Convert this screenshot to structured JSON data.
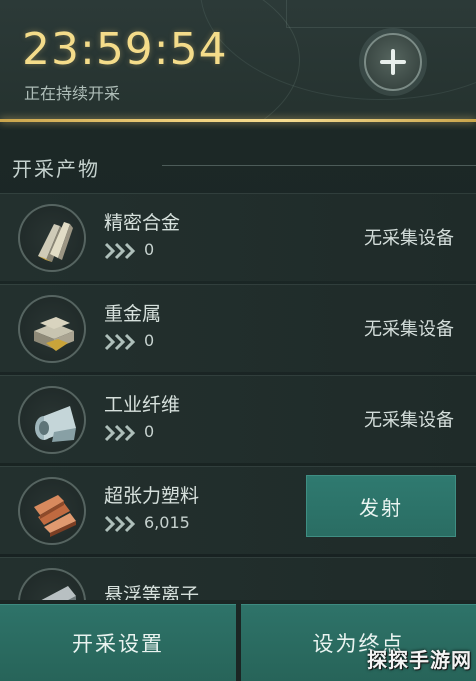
{
  "header": {
    "timer": "23:59:54",
    "status": "正在持续开采"
  },
  "section": {
    "title": "开采产物"
  },
  "items": [
    {
      "name": "精密合金",
      "rate": "0",
      "status": "无采集设备",
      "icon": "precision-alloy-icon"
    },
    {
      "name": "重金属",
      "rate": "0",
      "status": "无采集设备",
      "icon": "heavy-metal-icon"
    },
    {
      "name": "工业纤维",
      "rate": "0",
      "status": "无采集设备",
      "icon": "industrial-fiber-icon"
    },
    {
      "name": "超张力塑料",
      "rate": "6,015",
      "action": "发射",
      "icon": "tension-plastic-icon"
    },
    {
      "name": "悬浮等离子",
      "rate": "",
      "status": "",
      "icon": "plasma-icon"
    }
  ],
  "footer": {
    "left_label": "开采设置",
    "right_label": "设为终点"
  },
  "watermark": "探探手游网",
  "colors": {
    "accent_gold": "#f2d27e",
    "button_teal": "#2e7369",
    "chevron": "#aebfba"
  }
}
